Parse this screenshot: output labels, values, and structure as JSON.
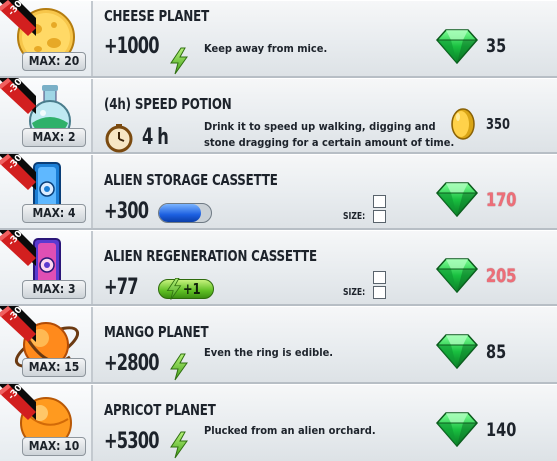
{
  "items": [
    {
      "name": "CHEESE PLANET",
      "max": "MAX: 20",
      "discount": "-30%",
      "value": "+1000",
      "description": "Keep away from mice.",
      "price": "35",
      "currency": "gem",
      "price_color": "normal"
    },
    {
      "name": "(4h) SPEED POTION",
      "max": "MAX: 2",
      "discount": "-30%",
      "value": "4 h",
      "description_lines": [
        "Drink it to speed up walking, digging and",
        "stone dragging for a certain amount of time."
      ],
      "price": "350",
      "currency": "coin",
      "price_color": "normal"
    },
    {
      "name": "ALIEN STORAGE CASSETTE",
      "max": "MAX: 4",
      "discount": "-30%",
      "value": "+300",
      "size_label": "SIZE:",
      "price": "170",
      "currency": "gem",
      "price_color": "red",
      "bar_fill": 0.8
    },
    {
      "name": "ALIEN REGENERATION CASSETTE",
      "max": "MAX: 3",
      "discount": "-30%",
      "value": "+77",
      "pill_text": "+1",
      "size_label": "SIZE:",
      "price": "205",
      "currency": "gem",
      "price_color": "red"
    },
    {
      "name": "MANGO PLANET",
      "max": "MAX: 15",
      "discount": "-30%",
      "value": "+2800",
      "description": "Even the ring is edible.",
      "price": "85",
      "currency": "gem",
      "price_color": "normal"
    },
    {
      "name": "APRICOT PLANET",
      "max": "MAX: 10",
      "discount": "-30%",
      "value": "+5300",
      "description": "Plucked from an alien orchard.",
      "price": "140",
      "currency": "gem",
      "price_color": "normal"
    }
  ],
  "colors": {
    "gem": "#1fc34a",
    "price_red": "#ee6e78",
    "ribbon": "#c81a1a",
    "energy": "#5fbf24"
  },
  "icons": [
    "cheese-planet-icon",
    "speed-potion-icon",
    "storage-cassette-icon",
    "regeneration-cassette-icon",
    "mango-planet-icon",
    "apricot-planet-icon",
    "gem-icon",
    "coin-icon",
    "lightning-icon",
    "stopwatch-icon"
  ]
}
